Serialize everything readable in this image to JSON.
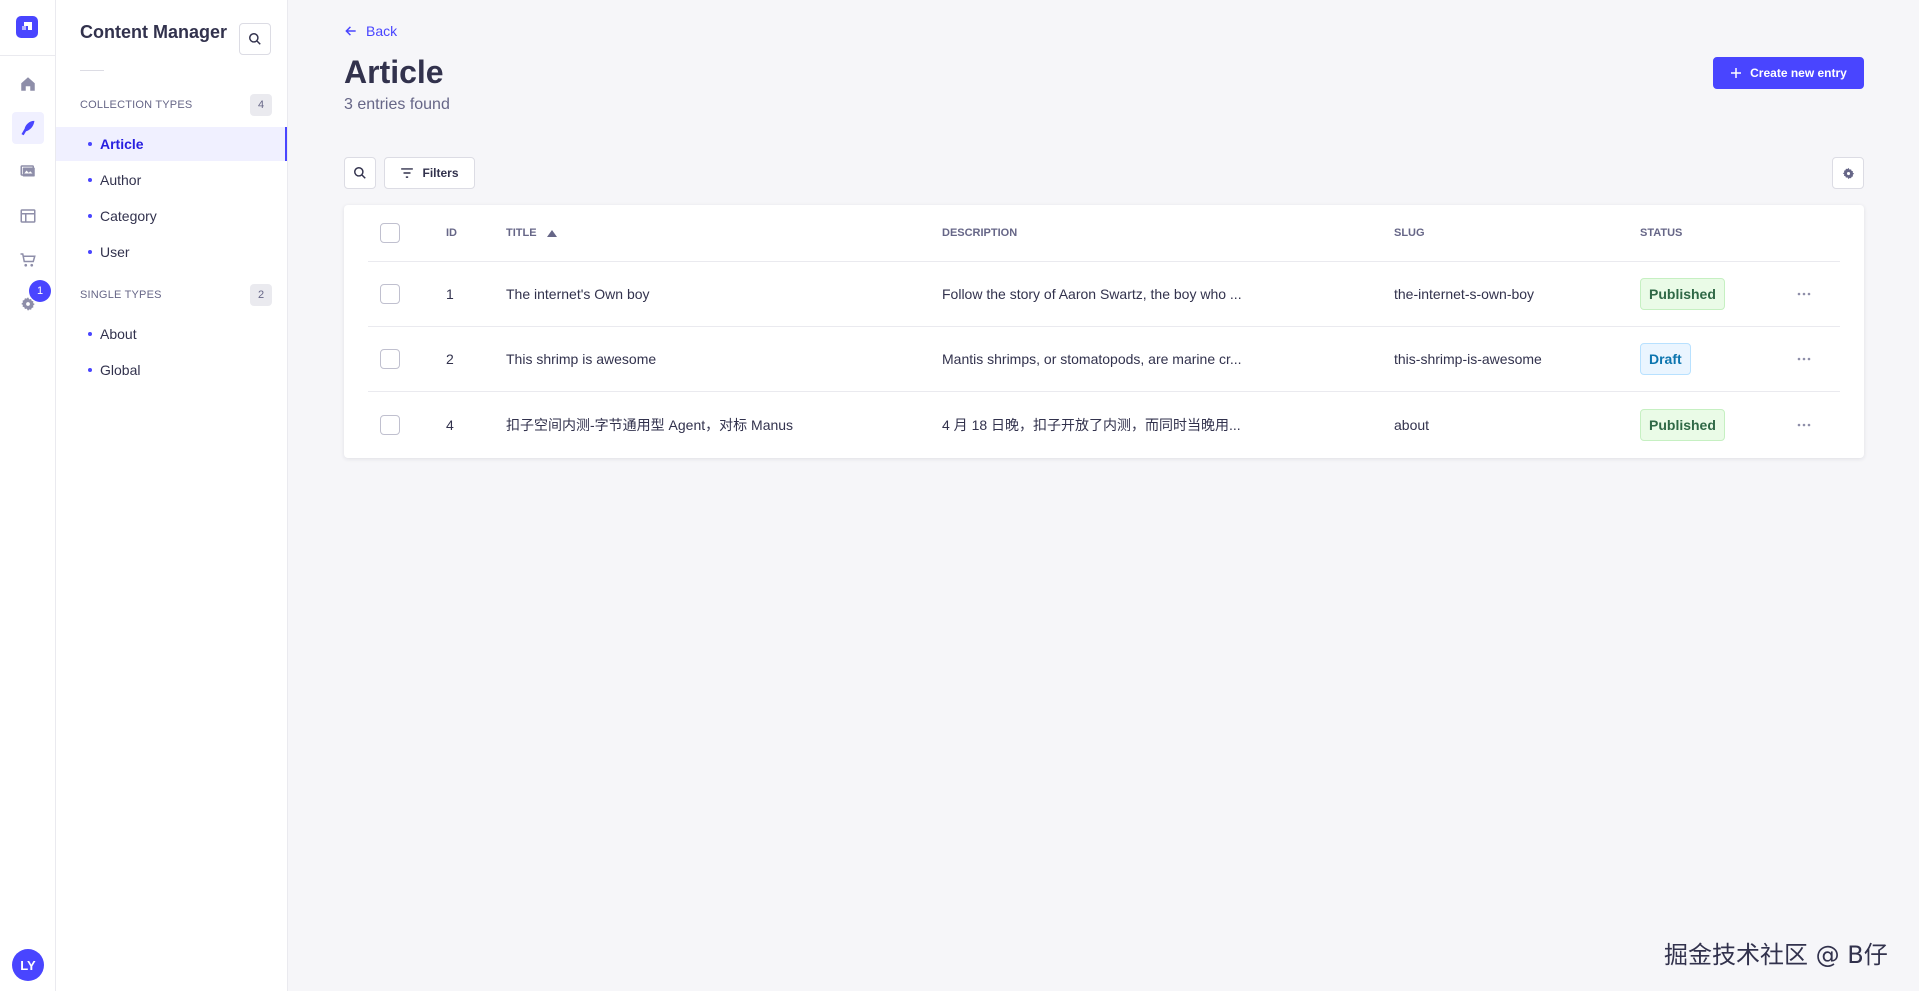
{
  "rail": {
    "items": [
      {
        "name": "home-icon"
      },
      {
        "name": "content-manager-icon"
      },
      {
        "name": "media-library-icon"
      },
      {
        "name": "content-type-builder-icon"
      },
      {
        "name": "marketplace-icon"
      },
      {
        "name": "settings-icon"
      }
    ],
    "settings_badge": "1",
    "avatar_initials": "LY"
  },
  "subnav": {
    "title": "Content Manager",
    "collection_types": {
      "label": "Collection types",
      "count": "4",
      "items": [
        {
          "label": "Article",
          "active": true
        },
        {
          "label": "Author"
        },
        {
          "label": "Category"
        },
        {
          "label": "User"
        }
      ]
    },
    "single_types": {
      "label": "Single types",
      "count": "2",
      "items": [
        {
          "label": "About"
        },
        {
          "label": "Global"
        }
      ]
    }
  },
  "header": {
    "back_label": "Back",
    "title": "Article",
    "entries_count": "3 entries found",
    "create_label": "Create new entry"
  },
  "toolbar": {
    "filters_label": "Filters"
  },
  "table": {
    "columns": {
      "id": "ID",
      "title": "Title",
      "description": "Description",
      "slug": "Slug",
      "status": "Status"
    },
    "rows": [
      {
        "id": "1",
        "title": "The internet's Own boy",
        "description": "Follow the story of Aaron Swartz, the boy who ...",
        "slug": "the-internet-s-own-boy",
        "status": "Published"
      },
      {
        "id": "2",
        "title": "This shrimp is awesome",
        "description": "Mantis shrimps, or stomatopods, are marine cr...",
        "slug": "this-shrimp-is-awesome",
        "status": "Draft"
      },
      {
        "id": "4",
        "title": "扣子空间内测-字节通用型 Agent，对标 Manus",
        "description": "4 月 18 日晚，扣子开放了内测，而同时当晚用...",
        "slug": "about",
        "status": "Published"
      }
    ]
  },
  "watermark": "掘金技术社区 @ B仔",
  "colors": {
    "primary": "#4945ff",
    "background": "#f6f6f9",
    "published_bg": "#eafbe7",
    "published_text": "#2f6846",
    "draft_bg": "#eaf5ff",
    "draft_text": "#0c75af"
  }
}
